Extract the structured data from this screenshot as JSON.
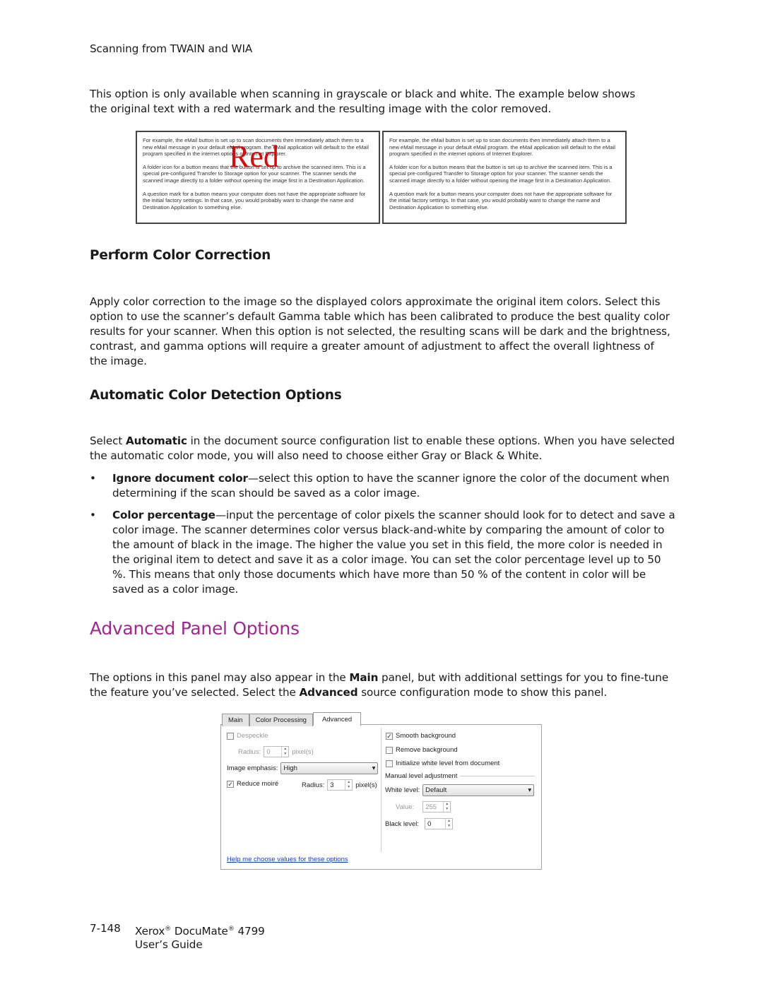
{
  "header": {
    "running_title": "Scanning from TWAIN and WIA"
  },
  "intro": "This option is only available when scanning in grayscale or black and white. The example below shows the original text with a red watermark and the resulting image with the color removed.",
  "example": {
    "paragraphs": [
      "For example, the eMail button is set up to scan documents then immediately attach them to a new eMail message in your default eMail program. the eMail application will default to the eMail program specified in the internet options of Internet Explorer.",
      "A folder icon for a button means that the button is set up to archive the scanned item. This is a special pre-configured Transfer to Storage option for your scanner. The scanner sends the scanned image directly to a folder without opening the image first in a Destination Application.",
      "A question mark for a button means your computer does not have the appropriate software for the initial factory settings. In that case, you would probably want to change the name and Destination Application to something else."
    ],
    "watermark": "Red",
    "watermark_color": "#d40000"
  },
  "sections": {
    "color_correction": {
      "title": "Perform Color Correction",
      "body": "Apply color correction to the image so the displayed colors approximate the original item colors. Select this option to use the scanner’s default Gamma table which has been calibrated to produce the best quality color results for your scanner. When this option is not selected, the resulting scans will be dark and the brightness, contrast, and gamma options will require a greater amount of adjustment to affect the overall lightness of the image."
    },
    "auto_color": {
      "title": "Automatic Color Detection Options",
      "body_pre": "Select ",
      "body_bold": "Automatic",
      "body_post": " in the document source configuration list to enable these options.  When you have selected the automatic color mode, you will also need to choose either Gray or Black & White.",
      "bullets": [
        {
          "term": "Ignore document color",
          "text": "—select this option to have the scanner ignore the color of the document when determining if the scan should be saved as a color image."
        },
        {
          "term": "Color percentage",
          "text": "—input the percentage of color pixels the scanner should look for to detect and save a color image.  The scanner determines color versus black-and-white by comparing the amount of color to the amount of black in the image.  The higher the value you set in this field, the more color is needed in the original item to detect and save it as a color image. You can set the color percentage level up to 50 %. This means that only those documents which have more than 50 %  of the content in color will be saved as a color image."
        }
      ]
    },
    "advanced": {
      "title": "Advanced Panel Options",
      "title_color": "#a0288c",
      "p1": "The options in this panel may also appear in the ",
      "b1": "Main",
      "p2": " panel, but with additional settings for you to fine-tune the feature you’ve selected. Select the ",
      "b2": "Advanced",
      "p3": " source configuration mode to show this panel."
    }
  },
  "panel": {
    "tabs": [
      "Main",
      "Color Processing",
      "Advanced"
    ],
    "active_tab": "Advanced",
    "despeckle": {
      "label": "Despeckle",
      "checked": false,
      "radius_label": "Radius:",
      "radius": "0",
      "unit": "pixel(s)"
    },
    "image_emphasis": {
      "label": "Image emphasis:",
      "value": "High"
    },
    "reduce_moire": {
      "label": "Reduce moiré",
      "checked": true,
      "radius_label": "Radius:",
      "radius": "3",
      "unit": "pixel(s)"
    },
    "smooth_background": {
      "label": "Smooth background",
      "checked": true
    },
    "remove_background": {
      "label": "Remove background",
      "checked": false
    },
    "init_white": {
      "label": "Initialize white level from document",
      "checked": false
    },
    "manual_label": "Manual level adjustment",
    "white_level": {
      "label": "White level:",
      "value": "Default"
    },
    "value": {
      "label": "Value:",
      "value": "255"
    },
    "black_level": {
      "label": "Black level:",
      "value": "0"
    },
    "help_link": "Help me choose values for these options"
  },
  "footer": {
    "page": "7-148",
    "product_a": "Xerox",
    "reg": "®",
    "product_b": " DocuMate",
    "product_c": " 4799",
    "guide": "User’s Guide"
  }
}
